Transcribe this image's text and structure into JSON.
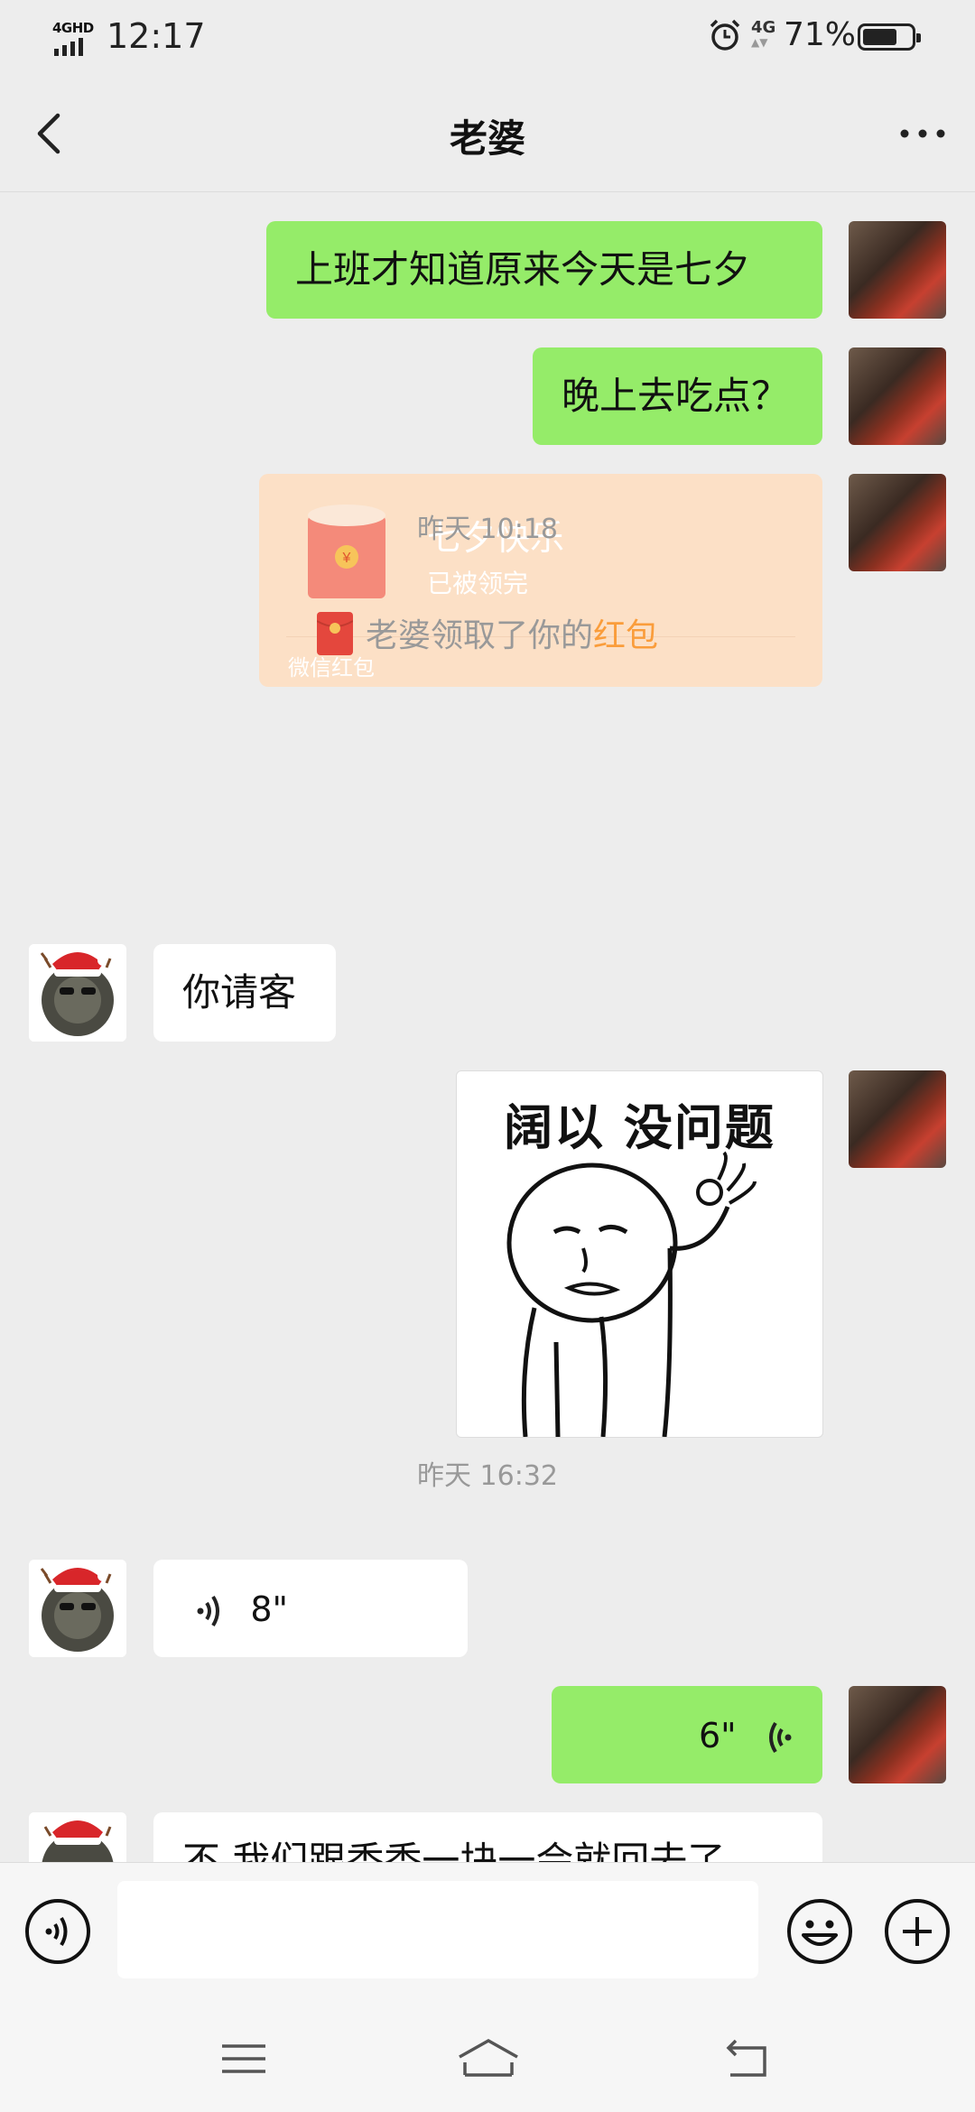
{
  "status_bar": {
    "network": "4GHD",
    "time": "12:17",
    "network2": "4G",
    "battery_percent": "71%",
    "battery_level": 0.71
  },
  "header": {
    "title": "老婆"
  },
  "messages": {
    "m1": "上班才知道原来今天是七夕",
    "m2": "晚上去吃点？",
    "red_packet": {
      "title": "七夕快乐",
      "status": "已被领完",
      "footer": "微信红包"
    },
    "time1": "昨天 10:18",
    "system": {
      "prefix": "老婆领取了你的",
      "highlight": "红包"
    },
    "m3": "你请客",
    "sticker_caption": "阔以 没问题",
    "time2": "昨天 16:32",
    "voice_her": "8\"",
    "voice_me": "6\"",
    "m4_partial": "不 我们跟香香一块一会就回去了"
  },
  "input_bar": {
    "value": "",
    "placeholder": ""
  },
  "colors": {
    "my_bubble": "#95ec69",
    "her_bubble": "#ffffff",
    "background": "#ededed",
    "red_packet_bg": "#fce0c6",
    "highlight": "#fa9d3b"
  },
  "icons": {
    "back": "back-chevron-icon",
    "more": "more-dots-icon",
    "voice_toggle": "voice-mode-icon",
    "emoji": "emoji-icon",
    "plus": "plus-icon",
    "nav_menu": "menu-icon",
    "nav_home": "home-icon",
    "nav_back": "return-icon"
  }
}
